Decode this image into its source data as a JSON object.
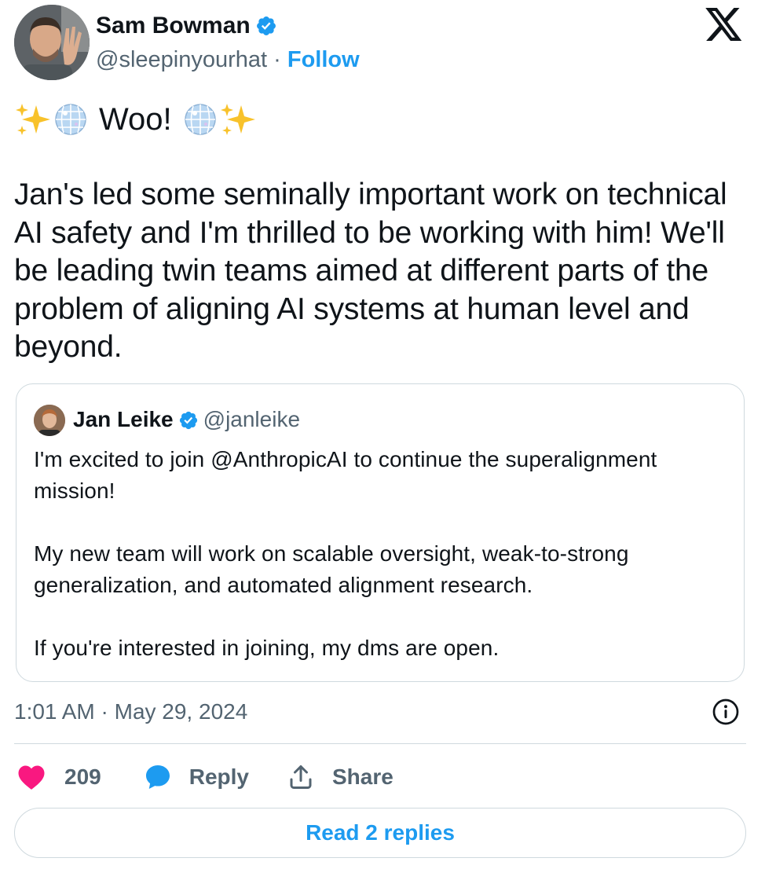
{
  "tweet": {
    "author": {
      "name": "Sam Bowman",
      "handle": "@sleepinyourhat",
      "separator": "·",
      "follow_label": "Follow",
      "avatar_icon": "avatar-photo-icon",
      "verified_icon": "verified-badge-icon"
    },
    "brand_icon": "x-logo-icon",
    "intro": {
      "text": "Woo!",
      "emojis": [
        "sparkles",
        "mirror-ball",
        "mirror-ball",
        "sparkles"
      ]
    },
    "text": "Jan's led some seminally important work on technical\nAI safety and I'm thrilled to be working with him! We'll\nbe leading twin teams aimed at different parts of the\nproblem of aligning AI systems at human level and\nbeyond.",
    "quote": {
      "name": "Jan Leike",
      "handle": "@janleike",
      "text": "I'm excited to join @AnthropicAI to continue the superalignment\nmission!\n\nMy new team will work on scalable oversight, weak-to-strong\ngeneralization, and automated alignment research.\n\nIf you're interested in joining, my dms are open."
    },
    "timestamp": "1:01 AM · May 29, 2024",
    "actions": {
      "like_count": "209",
      "reply_label": "Reply",
      "share_label": "Share"
    },
    "read_replies_label": "Read 2 replies"
  },
  "colors": {
    "accent": "#1d9bf0",
    "like": "#f91880",
    "secondary_text": "#536471",
    "border": "#cfd9de"
  }
}
